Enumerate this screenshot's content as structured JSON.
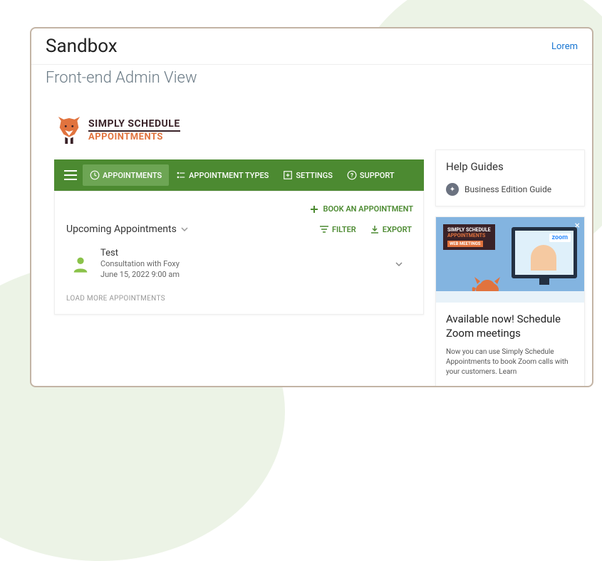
{
  "topbar": {
    "title": "Sandbox",
    "link": "Lorem"
  },
  "subtitle": "Front-end Admin View",
  "logo": {
    "line1": "SIMPLY SCHEDULE",
    "line2": "APPOINTMENTS"
  },
  "nav": {
    "items": [
      {
        "label": "APPOINTMENTS",
        "icon": "clock"
      },
      {
        "label": "APPOINTMENT TYPES",
        "icon": "list"
      },
      {
        "label": "SETTINGS",
        "icon": "plus-box"
      },
      {
        "label": "SUPPORT",
        "icon": "help"
      }
    ]
  },
  "main": {
    "book_label": "BOOK AN APPOINTMENT",
    "section_title": "Upcoming Appointments",
    "filter_label": "FILTER",
    "export_label": "EXPORT",
    "appointment": {
      "name": "Test",
      "type": "Consultation with Foxy",
      "datetime": "June 15, 2022 9:00 am"
    },
    "load_more": "LOAD MORE APPOINTMENTS"
  },
  "side": {
    "help_title": "Help Guides",
    "guide_link": "Business Edition Guide",
    "promo": {
      "banner_line1": "SIMPLY SCHEDULE",
      "banner_line2": "APPOINTMENTS",
      "banner_sub": "WEB MEETINGS",
      "zoom": "zoom",
      "title": "Available now! Schedule Zoom meetings",
      "body": "Now you can use Simply Schedule Appointments to book Zoom calls with your customers. Learn"
    }
  }
}
